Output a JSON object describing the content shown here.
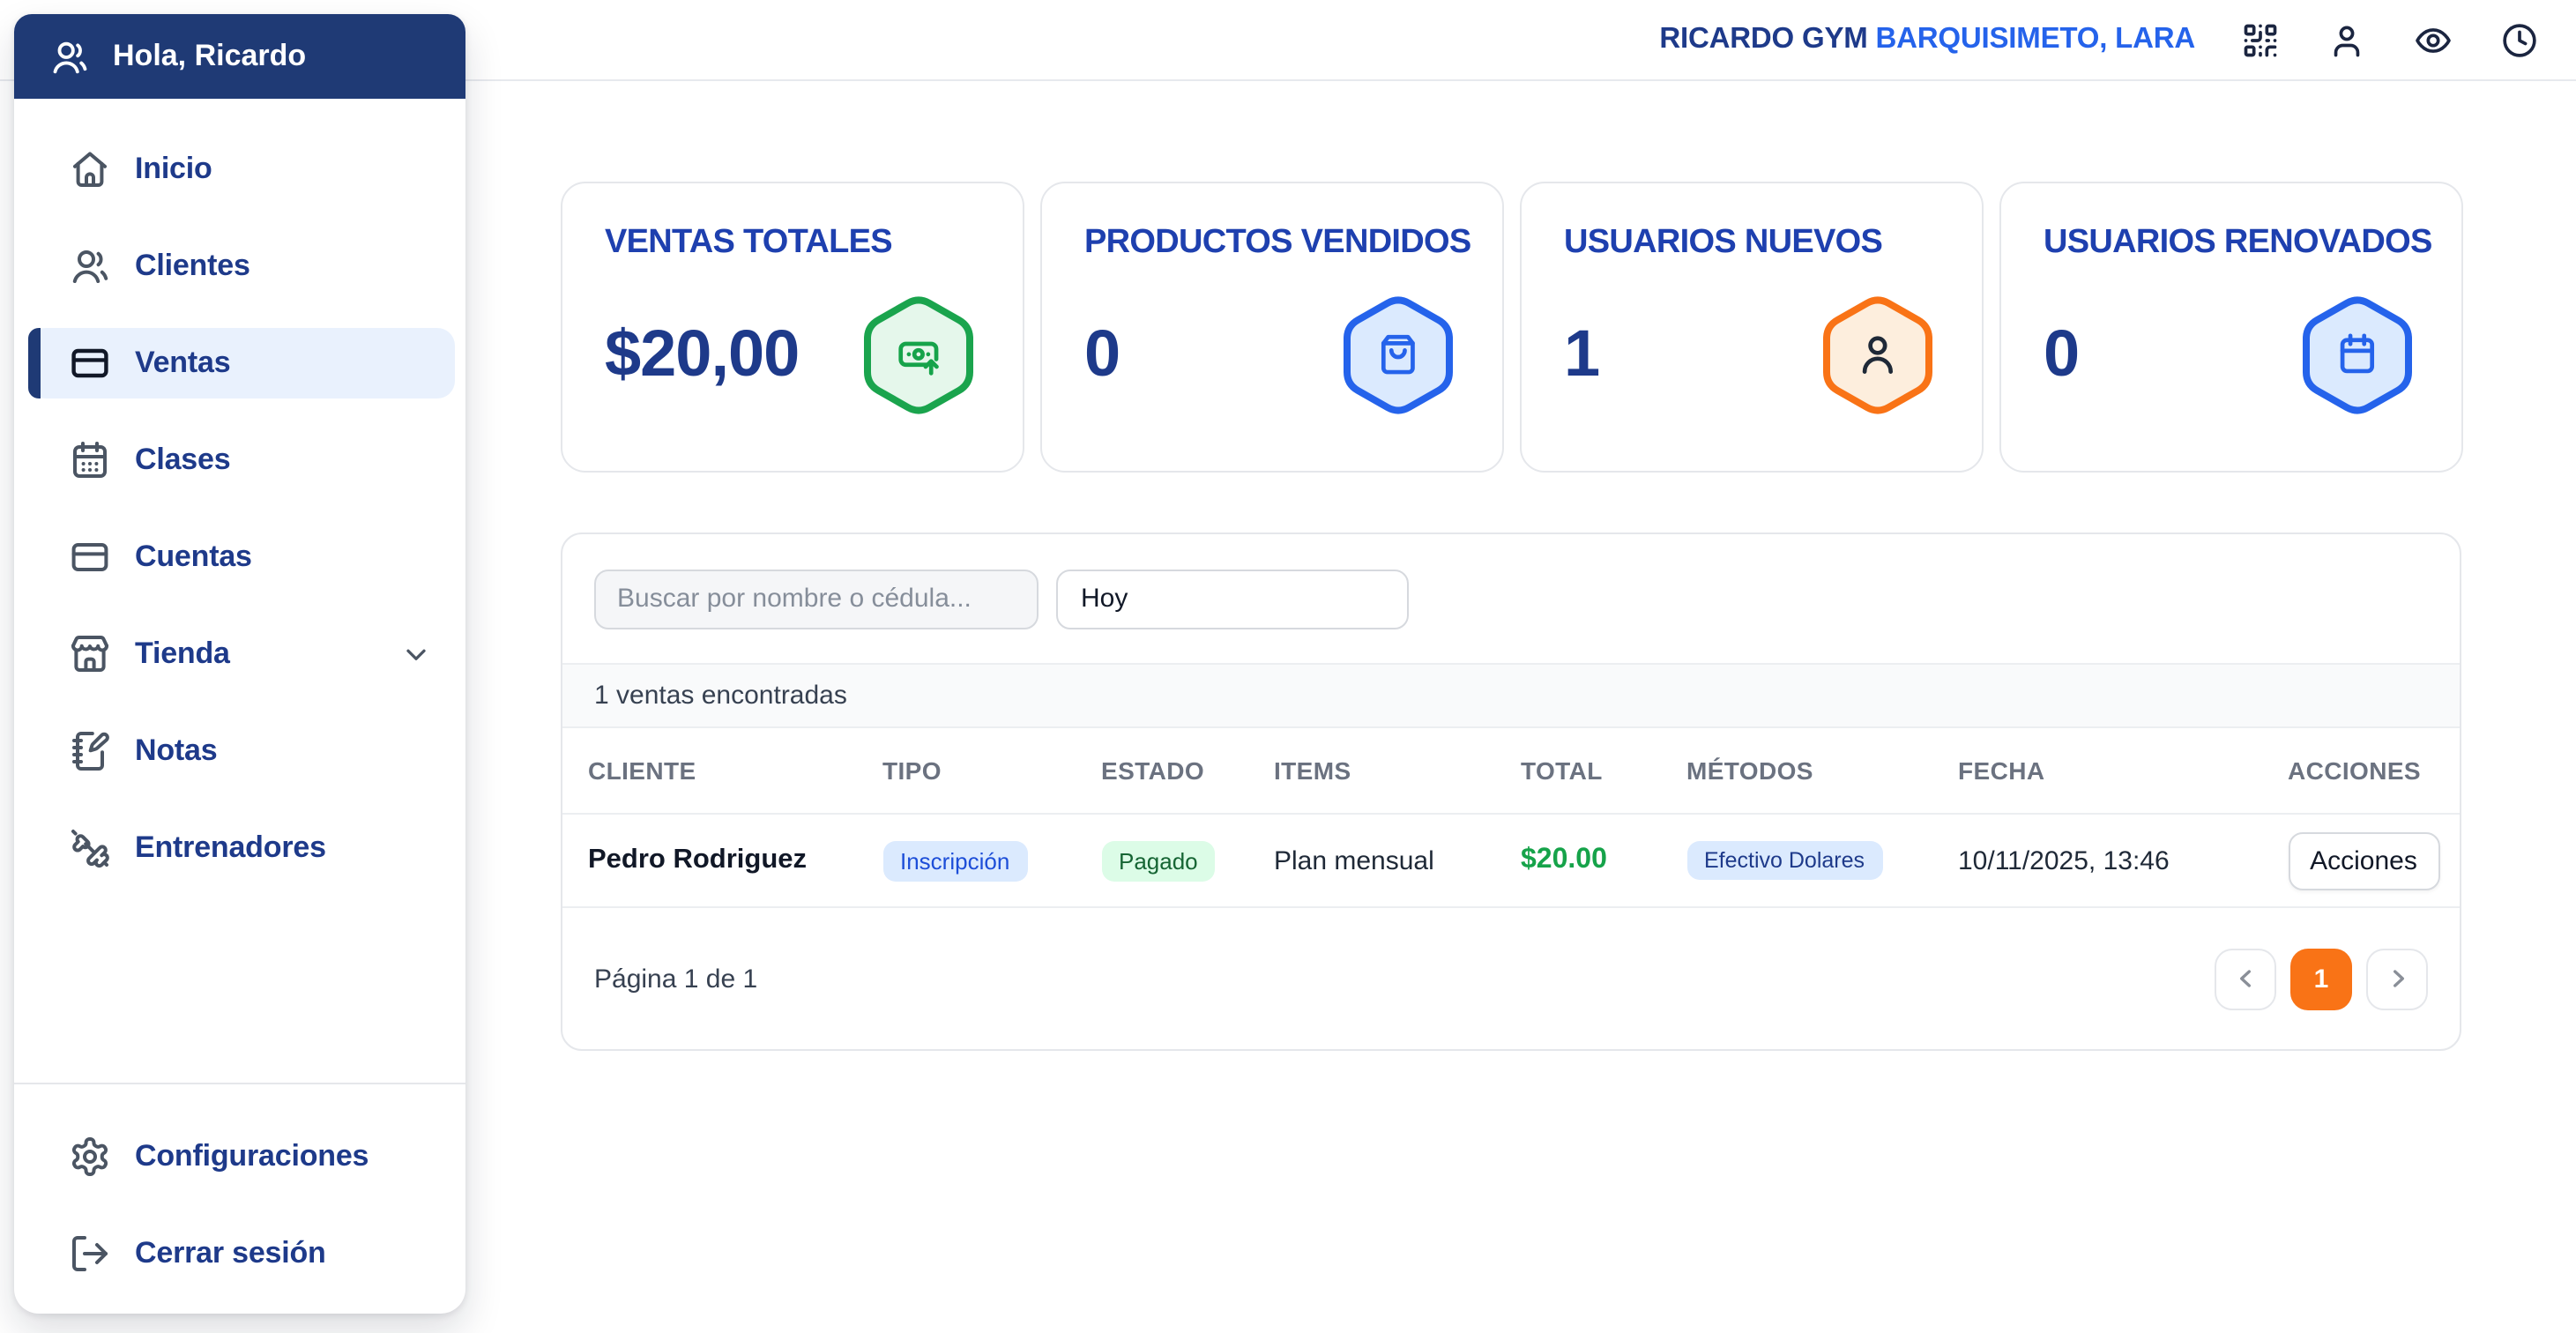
{
  "header": {
    "gym_name": "RICARDO GYM",
    "location": " BARQUISIMETO, LARA",
    "icons": [
      "qr-code",
      "user",
      "eye",
      "clock"
    ]
  },
  "sidebar": {
    "greeting": "Hola, Ricardo",
    "items": [
      {
        "label": "Inicio",
        "icon": "home"
      },
      {
        "label": "Clientes",
        "icon": "users"
      },
      {
        "label": "Ventas",
        "icon": "credit-card",
        "active": true
      },
      {
        "label": "Clases",
        "icon": "calendar-days"
      },
      {
        "label": "Cuentas",
        "icon": "credit-card"
      },
      {
        "label": "Tienda",
        "icon": "store",
        "chevron": "down"
      },
      {
        "label": "Notas",
        "icon": "notebook-pen"
      },
      {
        "label": "Entrenadores",
        "icon": "dumbbell"
      }
    ],
    "footer": [
      {
        "label": "Configuraciones",
        "icon": "gear"
      },
      {
        "label": "Cerrar sesión",
        "icon": "log-out"
      }
    ]
  },
  "stats": [
    {
      "title": "VENTAS TOTALES",
      "value": "$20,00",
      "icon": "banknote-arrow-up",
      "accent": "green"
    },
    {
      "title": "PRODUCTOS VENDIDOS",
      "value": "0",
      "icon": "shopping-bag",
      "accent": "blue"
    },
    {
      "title": "USUARIOS NUEVOS",
      "value": "1",
      "icon": "user",
      "accent": "orange"
    },
    {
      "title": "USUARIOS RENOVADOS",
      "value": "0",
      "icon": "calendar",
      "accent": "blue"
    }
  ],
  "sales": {
    "search_placeholder": "Buscar por nombre o cédula...",
    "date_filter": "Hoy",
    "results_count": "1 ventas encontradas",
    "columns": [
      "CLIENTE",
      "TIPO",
      "ESTADO",
      "ITEMS",
      "TOTAL",
      "MÉTODOS",
      "FECHA",
      "ACCIONES"
    ],
    "rows": [
      {
        "cliente": "Pedro Rodriguez",
        "tipo": "Inscripción",
        "estado": "Pagado",
        "items": "Plan mensual",
        "total": "$20.00",
        "metodos": "Efectivo Dolares",
        "fecha": "10/11/2025, 13:46",
        "acciones": "Acciones"
      }
    ],
    "pagination": {
      "label": "Página 1 de 1",
      "current_page": "1"
    }
  },
  "colors": {
    "sidebar_header_navy": "#1f3a75",
    "nav_text_blue": "#1e3a8a",
    "nav_active_bg": "#e9f1fd",
    "brand_blue": "#1e3a8a",
    "location_blue": "#2563eb",
    "card_title_blue": "#1e40af",
    "green_accent": "#1aa44d",
    "green_fill": "#e5f7eb",
    "blue_accent": "#2563eb",
    "blue_fill": "#dbeafe",
    "orange_accent": "#f97316",
    "orange_fill": "#fdeedd",
    "badge_tipo_bg": "#dbeafe",
    "badge_tipo_text": "#1d4ed8",
    "badge_estado_bg": "#dcfce7",
    "badge_estado_text": "#166534",
    "total_green": "#16a34a",
    "pagination_orange": "#f97316"
  }
}
